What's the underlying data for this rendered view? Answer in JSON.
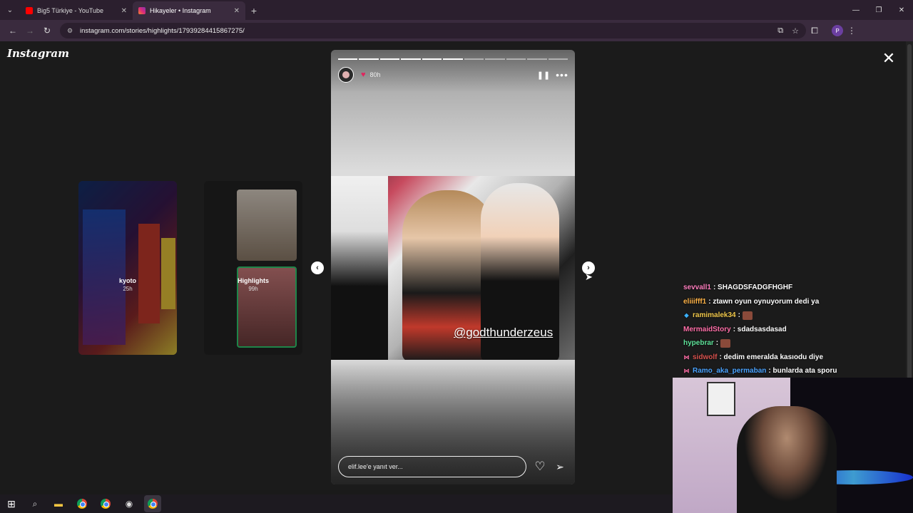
{
  "browser": {
    "tabs": [
      {
        "title": "Big5 Türkiye - YouTube",
        "active": false,
        "favicon_color": "#ff0000"
      },
      {
        "title": "Hikayeler • Instagram",
        "active": true,
        "favicon_color": "#e1306c"
      }
    ],
    "url": "instagram.com/stories/highlights/17939284415867275/",
    "icons": [
      "back-icon",
      "forward-icon",
      "reload-icon",
      "site-info-icon",
      "install-icon",
      "star-icon",
      "extensions-icon"
    ],
    "profile_initial": "P"
  },
  "instagram": {
    "logo": "Instagram",
    "previews": [
      {
        "label": "kyoto",
        "time": "25h"
      },
      {
        "label": "Highlights",
        "time": "99h"
      }
    ],
    "story": {
      "time_ago": "80h",
      "mention": "@godthunderzeus",
      "reply_placeholder": "elif.lee'e yanıt ver...",
      "segments": 11,
      "active_segment": 6,
      "progress": 0.55
    }
  },
  "chat": [
    {
      "user": "sevvall1",
      "color": "#ff7fbf",
      "badge": "",
      "msg": ": SHAGDSFADGFHGHF",
      "emote": false
    },
    {
      "user": "eliiifff1",
      "color": "#ffb347",
      "badge": "",
      "msg": ": ztawn oyun oynuyorum dedi ya",
      "emote": false
    },
    {
      "user": "ramimalek34",
      "color": "#f2c94c",
      "badge": "diamond",
      "msg": ":",
      "emote": true
    },
    {
      "user": "MermaidStory",
      "color": "#ff6fa8",
      "badge": "",
      "msg": ": sdadsasdasad",
      "emote": false
    },
    {
      "user": "hypebrar",
      "color": "#5fe39a",
      "badge": "",
      "msg": ":",
      "emote": true
    },
    {
      "user": "sidwolf",
      "color": "#d9534f",
      "badge": "bow",
      "msg": ": dedim emeralda kasıodu diye",
      "emote": false
    },
    {
      "user": "Ramo_aka_permaban",
      "color": "#4aa3ff",
      "badge": "bow",
      "msg": ": bunlarda ata sporu",
      "emote": false
    }
  ],
  "colors": {
    "accent": "#e0245e",
    "chrome_frame": "#2b1f2e",
    "chrome_toolbar": "#3a2b3e"
  }
}
